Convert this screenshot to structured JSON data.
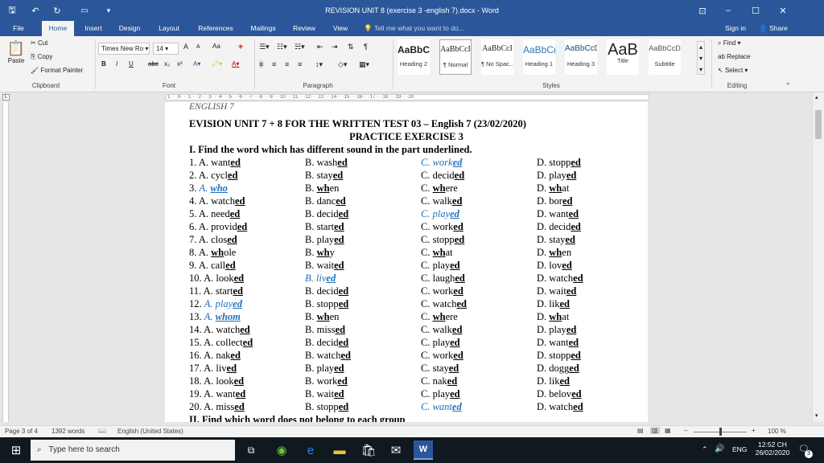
{
  "window": {
    "title": "REVISION UNIT 8 (exercise 3 -english 7).docx - Word",
    "controls": {
      "ribbon_display": "⊡",
      "minimize": "–",
      "maximize": "☐",
      "close": "✕"
    }
  },
  "tabs": [
    "File",
    "Home",
    "Insert",
    "Design",
    "Layout",
    "References",
    "Mailings",
    "Review",
    "View"
  ],
  "tell_me": "Tell me what you want to do...",
  "signin": "Sign in",
  "share": "Share",
  "clipboard": {
    "paste": "Paste",
    "cut": "Cut",
    "copy": "Copy",
    "format_painter": "Format Painter",
    "label": "Clipboard"
  },
  "font": {
    "name": "Times New Ro",
    "size": "14",
    "label": "Font",
    "bold": "B",
    "italic": "I",
    "underline": "U",
    "strike": "abc",
    "sub": "x₂",
    "sup": "x²",
    "grow": "A",
    "shrink": "A",
    "case": "Aa"
  },
  "paragraph": {
    "label": "Paragraph"
  },
  "styles": {
    "label": "Styles",
    "tiles": [
      {
        "preview": "AaBbC",
        "name": "Heading 2"
      },
      {
        "preview": "AaBbCcI",
        "name": "¶ Normal"
      },
      {
        "preview": "AaBbCcI",
        "name": "¶ No Spac..."
      },
      {
        "preview": "AaBbC(",
        "name": "Heading 1"
      },
      {
        "preview": "AaBbCcD",
        "name": "Heading 3"
      },
      {
        "preview": "AaB",
        "name": "Title"
      },
      {
        "preview": "AaBbCcD",
        "name": "Subtitle"
      }
    ]
  },
  "editing": {
    "find": "Find",
    "replace": "Replace",
    "select": "Select",
    "label": "Editing"
  },
  "ruler_text": "·1· · ·X· · ·1· · ·2· · ·3· · ·4· · ·5· · ·6· · ·7· · ·8· · ·9· · ·10· · ·11· · ·12· · ·13· · ·14· · ·15· · ·16· · ·17· · ·18· · ·19· · ·20",
  "document": {
    "header": "ENGLISH 7",
    "title": "EVISION UNIT 7 + 8 FOR THE WRITTEN TEST 03 – English 7 (23/02/2020)",
    "subtitle": "PRACTICE EXERCISE 3",
    "section1": "I. Find the word which has different sound in the part underlined.",
    "section2": "II. Find which word does not belong to each group",
    "rows": [
      {
        "n": "1.",
        "a": [
          "A. ",
          "want",
          "ed",
          ""
        ],
        "b": [
          "B. ",
          "wash",
          "ed",
          ""
        ],
        "c": [
          "C. ",
          "work",
          "ed",
          "blue"
        ],
        "d": [
          "D. ",
          "stopp",
          "ed",
          ""
        ]
      },
      {
        "n": "2.",
        "a": [
          "A. ",
          "cycl",
          "ed",
          ""
        ],
        "b": [
          "B. ",
          "stay",
          "ed",
          ""
        ],
        "c": [
          "C. ",
          "decid",
          "ed",
          ""
        ],
        "d": [
          "D. ",
          "play",
          "ed",
          ""
        ]
      },
      {
        "n": "3.",
        "a": [
          "A. ",
          "",
          "who",
          "blue"
        ],
        "b": [
          "B. ",
          "",
          "wh",
          "en"
        ],
        "c": [
          "C. ",
          "",
          "wh",
          "ere"
        ],
        "d": [
          "D. ",
          "",
          "wh",
          "at"
        ]
      },
      {
        "n": "4.",
        "a": [
          "A. ",
          "watch",
          "ed",
          ""
        ],
        "b": [
          "B. ",
          "danc",
          "ed",
          ""
        ],
        "c": [
          "C. ",
          "walk",
          "ed",
          ""
        ],
        "d": [
          "D. ",
          "bor",
          "ed",
          ""
        ]
      },
      {
        "n": "5.",
        "a": [
          "A. ",
          "need",
          "ed",
          ""
        ],
        "b": [
          "B. ",
          "decid",
          "ed",
          ""
        ],
        "c": [
          "C. ",
          "play",
          "ed",
          "blue"
        ],
        "d": [
          "D. ",
          "want",
          "ed",
          ""
        ]
      },
      {
        "n": "6.",
        "a": [
          "A. ",
          "provid",
          "ed",
          ""
        ],
        "b": [
          "B. ",
          "start",
          "ed",
          ""
        ],
        "c": [
          "C. ",
          "work",
          "ed",
          ""
        ],
        "d": [
          "D. ",
          "decid",
          "ed",
          ""
        ]
      },
      {
        "n": "7.",
        "a": [
          "A. ",
          "clos",
          "ed",
          ""
        ],
        "b": [
          "B. ",
          "play",
          "ed",
          ""
        ],
        "c": [
          "C. ",
          "stopp",
          "ed",
          ""
        ],
        "d": [
          "D. ",
          "stay",
          "ed",
          ""
        ]
      },
      {
        "n": "8.",
        "a": [
          "A. ",
          "",
          "wh",
          "ole"
        ],
        "b": [
          "B. ",
          "",
          "wh",
          "y"
        ],
        "c": [
          "C. ",
          "",
          "wh",
          "at"
        ],
        "d": [
          "D. ",
          "",
          "wh",
          "en"
        ]
      },
      {
        "n": "9.",
        "a": [
          "A. ",
          "call",
          "ed",
          ""
        ],
        "b": [
          "B. ",
          "wait",
          "ed",
          ""
        ],
        "c": [
          "C. ",
          "play",
          "ed",
          ""
        ],
        "d": [
          "D. ",
          "lov",
          "ed",
          ""
        ]
      },
      {
        "n": "10.",
        "a": [
          "A. ",
          "look",
          "ed",
          ""
        ],
        "b": [
          "B. ",
          "liv",
          "ed",
          "blue"
        ],
        "c": [
          "C. ",
          "laugh",
          "ed",
          ""
        ],
        "d": [
          "D. ",
          "watch",
          "ed",
          ""
        ]
      },
      {
        "n": "11.",
        "a": [
          "A. ",
          "start",
          "ed",
          ""
        ],
        "b": [
          "B. ",
          "decid",
          "ed",
          ""
        ],
        "c": [
          "C. ",
          "work",
          "ed",
          ""
        ],
        "d": [
          "D. ",
          "wait",
          "ed",
          ""
        ]
      },
      {
        "n": "12.",
        "a": [
          "A. ",
          "play",
          "ed",
          "blue"
        ],
        "b": [
          "B. ",
          "stopp",
          "ed",
          ""
        ],
        "c": [
          "C. ",
          "watch",
          "ed",
          ""
        ],
        "d": [
          "D. ",
          "lik",
          "ed",
          ""
        ]
      },
      {
        "n": "13.",
        "a": [
          "A. ",
          "",
          "whom",
          "blue"
        ],
        "b": [
          "B. ",
          "",
          "wh",
          "en"
        ],
        "c": [
          "C. ",
          "",
          "wh",
          "ere"
        ],
        "d": [
          "D. ",
          "",
          "wh",
          "at"
        ]
      },
      {
        "n": "14.",
        "a": [
          "A. ",
          "watch",
          "ed",
          ""
        ],
        "b": [
          "B. ",
          "miss",
          "ed",
          ""
        ],
        "c": [
          "C. ",
          "walk",
          "ed",
          ""
        ],
        "d": [
          "D. ",
          "play",
          "ed",
          ""
        ]
      },
      {
        "n": "15.",
        "a": [
          "A. ",
          "collect",
          "ed",
          ""
        ],
        "b": [
          "B. ",
          "decid",
          "ed",
          ""
        ],
        "c": [
          "C. ",
          "play",
          "ed",
          ""
        ],
        "d": [
          "D. ",
          "want",
          "ed",
          ""
        ]
      },
      {
        "n": "16.",
        "a": [
          "A. ",
          "nak",
          "ed",
          ""
        ],
        "b": [
          "B. ",
          "watch",
          "ed",
          ""
        ],
        "c": [
          "C. ",
          "work",
          "ed",
          ""
        ],
        "d": [
          "D. ",
          "stopp",
          "ed",
          ""
        ]
      },
      {
        "n": "17.",
        "a": [
          "A. ",
          "liv",
          "ed",
          ""
        ],
        "b": [
          "B. ",
          "play",
          "ed",
          ""
        ],
        "c": [
          "C. ",
          "stay",
          "ed",
          ""
        ],
        "d": [
          "D. ",
          "dogg",
          "ed",
          ""
        ]
      },
      {
        "n": "18.",
        "a": [
          "A. ",
          "look",
          "ed",
          ""
        ],
        "b": [
          "B. ",
          "work",
          "ed",
          ""
        ],
        "c": [
          "C. ",
          "nak",
          "ed",
          ""
        ],
        "d": [
          "D. ",
          "lik",
          "ed",
          ""
        ]
      },
      {
        "n": "19.",
        "a": [
          "A. ",
          "want",
          "ed",
          ""
        ],
        "b": [
          "B. ",
          "wait",
          "ed",
          ""
        ],
        "c": [
          "C. ",
          "play",
          "ed",
          ""
        ],
        "d": [
          "D. ",
          "belov",
          "ed",
          ""
        ]
      },
      {
        "n": "20.",
        "a": [
          "A. ",
          "miss",
          "ed",
          ""
        ],
        "b": [
          "B. ",
          "stopp",
          "ed",
          ""
        ],
        "c": [
          "C. ",
          "want",
          "ed",
          "blue"
        ],
        "d": [
          "D. ",
          "watch",
          "ed",
          ""
        ]
      }
    ]
  },
  "status": {
    "page": "Page 3 of 4",
    "words": "1392 words",
    "language": "English (United States)",
    "zoom": "100 %"
  },
  "taskbar": {
    "search": "Type here to search",
    "time": "12:52 CH",
    "date": "26/02/2020",
    "lang": "ENG",
    "notif": "3"
  },
  "colors": {
    "accent": "#2b579a",
    "answer": "#1f6fbf"
  }
}
